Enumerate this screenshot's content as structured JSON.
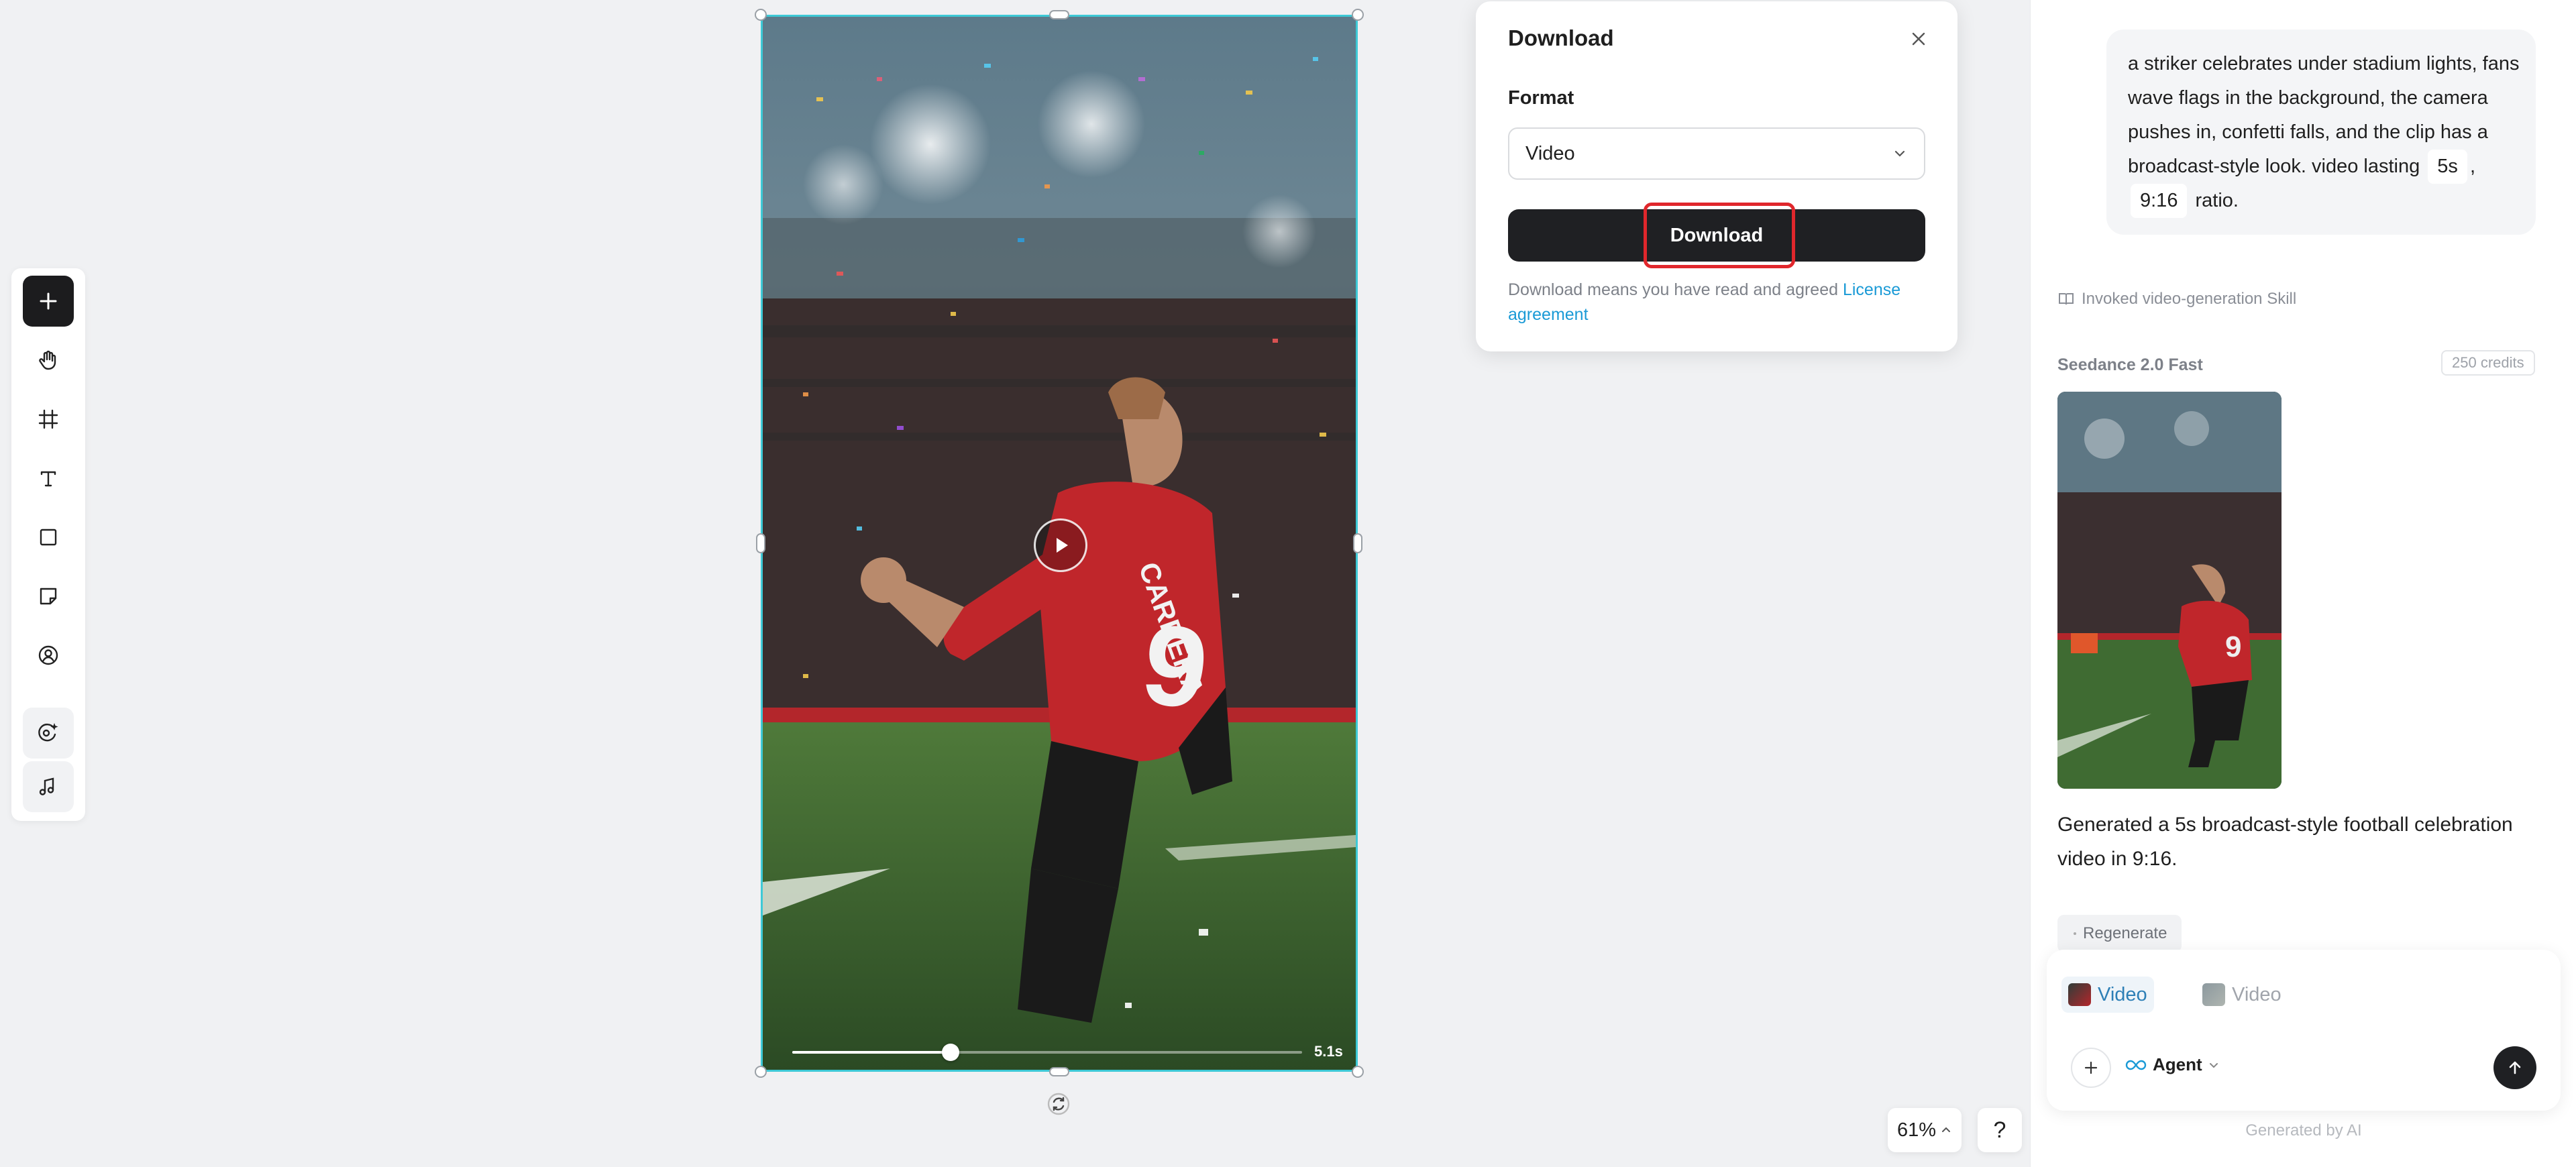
{
  "toolbar": {
    "tools": [
      {
        "name": "add",
        "icon": "plus-icon"
      },
      {
        "name": "pan",
        "icon": "hand-icon"
      },
      {
        "name": "frame",
        "icon": "frame-icon"
      },
      {
        "name": "text",
        "icon": "text-icon"
      },
      {
        "name": "rectangle",
        "icon": "square-icon"
      },
      {
        "name": "sticky-note",
        "icon": "sticky-note-icon"
      },
      {
        "name": "avatar",
        "icon": "person-circle-icon"
      },
      {
        "name": "ai-generate",
        "icon": "sparkle-palette-icon"
      },
      {
        "name": "audio",
        "icon": "music-note-icon"
      }
    ]
  },
  "canvas": {
    "video": {
      "duration_label": "5.1s",
      "progress": 0.31,
      "jersey_number": "9",
      "jersey_text": "CARRERA"
    }
  },
  "download_popover": {
    "title": "Download",
    "format_label": "Format",
    "format_value": "Video",
    "button_label": "Download",
    "disclaimer": "Download means you have read and agreed ",
    "license_link": "License agreement"
  },
  "chat": {
    "prompt": {
      "text": "a striker celebrates under stadium lights, fans wave flags in the background, the camera pushes in, confetti falls, and the clip has a broadcast-style look. video lasting",
      "duration_chip": "5s",
      "separator": ",",
      "ratio_chip": "9:16",
      "suffix": "ratio."
    },
    "skill_line": "Invoked video-generation Skill",
    "model_name": "Seedance 2.0 Fast",
    "credits": "250 credits",
    "result_caption": "Generated a 5s broadcast-style football celebration video in 9:16.",
    "regenerate_label": "Regenerate"
  },
  "composer": {
    "references": [
      {
        "label": "Video",
        "active": true
      },
      {
        "label": "Video",
        "active": false
      }
    ],
    "agent_label": "Agent"
  },
  "footer_note": "Generated by AI",
  "zoom": {
    "level": "61%"
  },
  "help_label": "?",
  "colors": {
    "accent": "#3ec9d6",
    "highlight": "#e0272c",
    "link": "#1a9ad6",
    "button_dark": "#1f2023"
  }
}
